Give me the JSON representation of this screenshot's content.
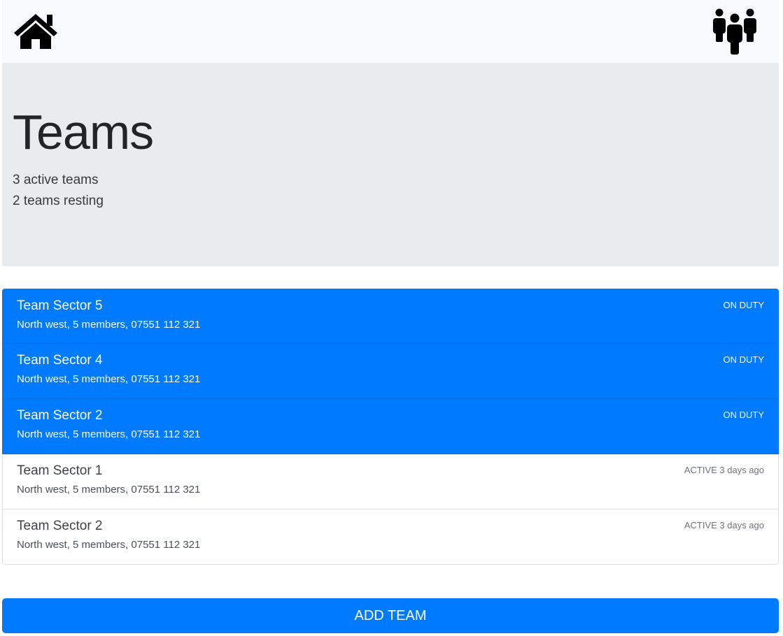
{
  "navbar": {
    "home_icon": "home-icon",
    "teams_icon": "users-icon"
  },
  "hero": {
    "title": "Teams",
    "active_summary": "3 active teams",
    "resting_summary": "2 teams resting"
  },
  "teams": [
    {
      "name": "Team Sector 5",
      "details": "North west, 5 members, 07551 112 321",
      "status": "ON DUTY",
      "on_duty": true
    },
    {
      "name": "Team Sector 4",
      "details": "North west, 5 members, 07551 112 321",
      "status": "ON DUTY",
      "on_duty": true
    },
    {
      "name": "Team Sector 2",
      "details": "North west, 5 members, 07551 112 321",
      "status": "ON DUTY",
      "on_duty": true
    },
    {
      "name": "Team Sector 1",
      "details": "North west, 5 members, 07551 112 321",
      "status": "ACTIVE 3 days ago",
      "on_duty": false
    },
    {
      "name": "Team Sector 2",
      "details": "North west, 5 members, 07551 112 321",
      "status": "ACTIVE 3 days ago",
      "on_duty": false
    }
  ],
  "actions": {
    "add_team_label": "ADD TEAM"
  },
  "colors": {
    "primary": "#007bff",
    "navbar_bg": "#f8f9fa",
    "hero_bg": "#e9ecef"
  }
}
